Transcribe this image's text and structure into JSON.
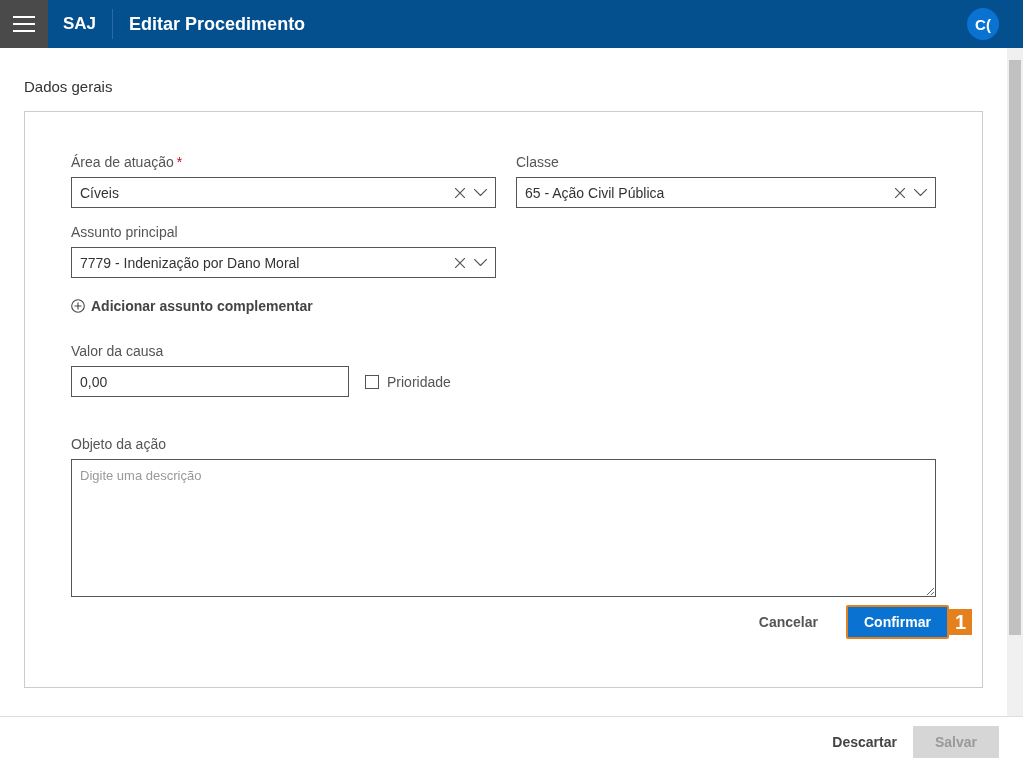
{
  "header": {
    "app_name": "SAJ",
    "title": "Editar Procedimento",
    "avatar": "C("
  },
  "section_title": "Dados gerais",
  "selects": [
    {
      "label": "Área de atuação",
      "required_mark": "*",
      "value": "Cíveis"
    },
    {
      "label": "Classe",
      "value": "65 - Ação Civil Pública"
    },
    {
      "label": "Assunto principal",
      "value": "7779 - Indenização por Dano Moral"
    }
  ],
  "add_link": "Adicionar assunto complementar",
  "valor": {
    "label": "Valor da causa",
    "value": "0,00"
  },
  "prioridade": {
    "label": "Prioridade",
    "checked": false
  },
  "objeto": {
    "label": "Objeto da ação",
    "placeholder": "Digite uma descrição"
  },
  "form_buttons": {
    "cancel": "Cancelar",
    "confirm": "Confirmar",
    "step": "1"
  },
  "footer_buttons": [
    {
      "label": "Descartar",
      "kind": "link",
      "disabled": false
    },
    {
      "label": "Salvar",
      "kind": "primary",
      "disabled": true
    }
  ]
}
